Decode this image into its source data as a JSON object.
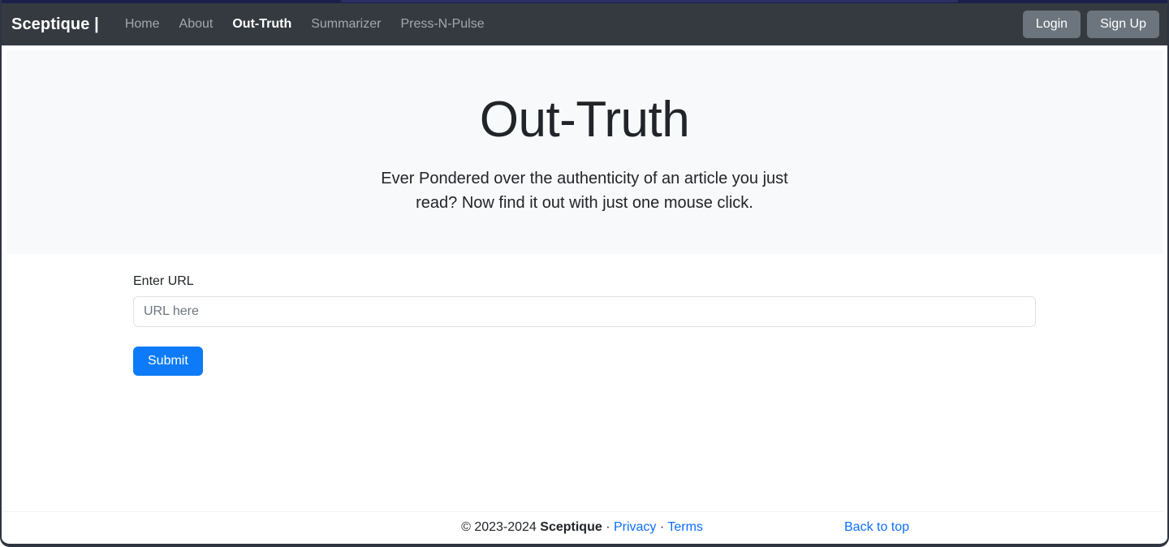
{
  "navbar": {
    "brand": "Sceptique |",
    "links": [
      {
        "label": "Home",
        "active": false
      },
      {
        "label": "About",
        "active": false
      },
      {
        "label": "Out-Truth",
        "active": true
      },
      {
        "label": "Summarizer",
        "active": false
      },
      {
        "label": "Press-N-Pulse",
        "active": false
      }
    ],
    "login_label": "Login",
    "signup_label": "Sign Up",
    "bg_color": "#343a40",
    "button_color": "#6c757d"
  },
  "hero": {
    "title": "Out-Truth",
    "subtitle": "Ever Pondered over the authenticity of an article you just read? Now find it out with just one mouse click.",
    "bg_color": "#f8f9fa"
  },
  "form": {
    "label": "Enter URL",
    "input_value": "",
    "input_placeholder": "URL here",
    "submit_label": "Submit",
    "submit_color": "#0d7bf7"
  },
  "footer": {
    "copyright": "© 2023-2024 ",
    "brand": "Sceptique",
    "separator_1": " · ",
    "privacy_label": "Privacy",
    "separator_2": " · ",
    "terms_label": "Terms",
    "back_to_top_label": "Back to top",
    "link_color": "#0d6efd"
  }
}
